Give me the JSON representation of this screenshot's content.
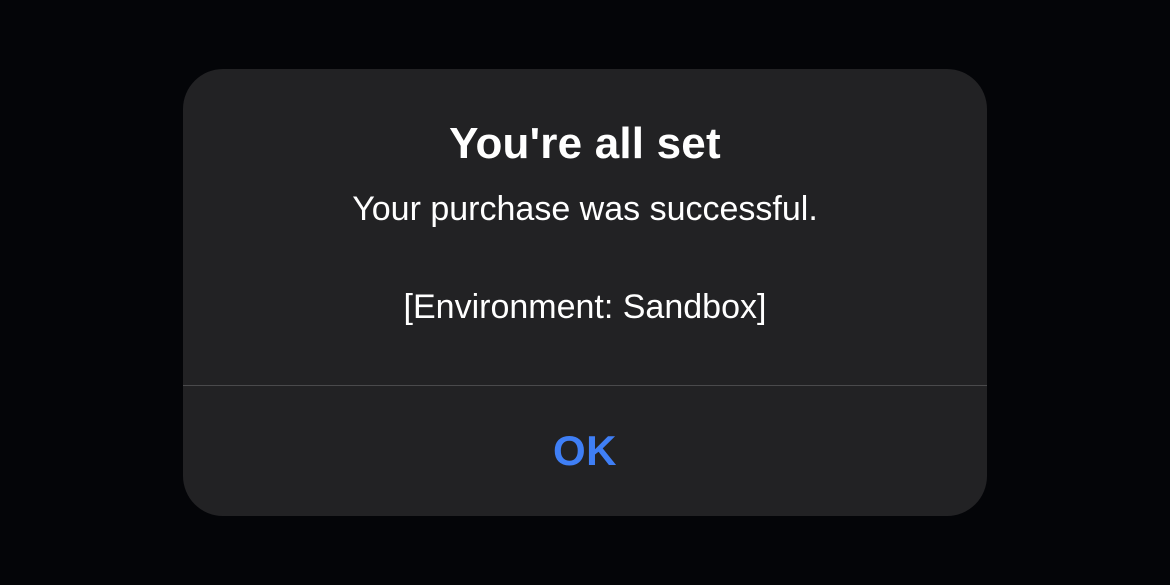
{
  "alert": {
    "title": "You're all set",
    "message": "Your purchase was successful.",
    "environment": "[Environment: Sandbox]",
    "ok_label": "OK"
  }
}
